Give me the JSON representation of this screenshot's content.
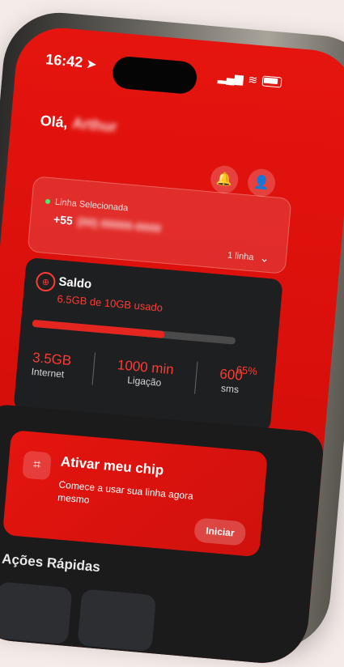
{
  "status_bar": {
    "time": "16:42"
  },
  "header": {
    "greeting": "Olá,",
    "name_redacted": "Arthur"
  },
  "line_card": {
    "label": "Linha Selecionada",
    "country_code": "+55",
    "number_redacted": "(00) 00000-0000",
    "lines_count": "1 linha"
  },
  "balance": {
    "title": "Saldo",
    "usage_text": "6.5GB de 10GB usado",
    "percent_text": "65%",
    "progress_fraction": 0.65,
    "metrics": [
      {
        "value": "3.5GB",
        "label": "Internet"
      },
      {
        "value": "1000 min",
        "label": "Ligação"
      },
      {
        "value": "600",
        "label": "sms"
      }
    ]
  },
  "chip_card": {
    "title": "Ativar meu chip",
    "subtitle": "Comece a usar sua linha agora mesmo",
    "button": "Iniciar"
  },
  "quick_actions": {
    "title": "Ações Rápidas"
  },
  "colors": {
    "brand_red": "#e5140f",
    "dark_card": "#1e1f21",
    "status_green": "#3ef26d"
  },
  "icons": [
    "location-arrow-icon",
    "signal-icon",
    "wifi-icon",
    "battery-icon",
    "bell-icon",
    "user-icon",
    "chevron-down-icon",
    "balance-icon",
    "chip-icon"
  ]
}
